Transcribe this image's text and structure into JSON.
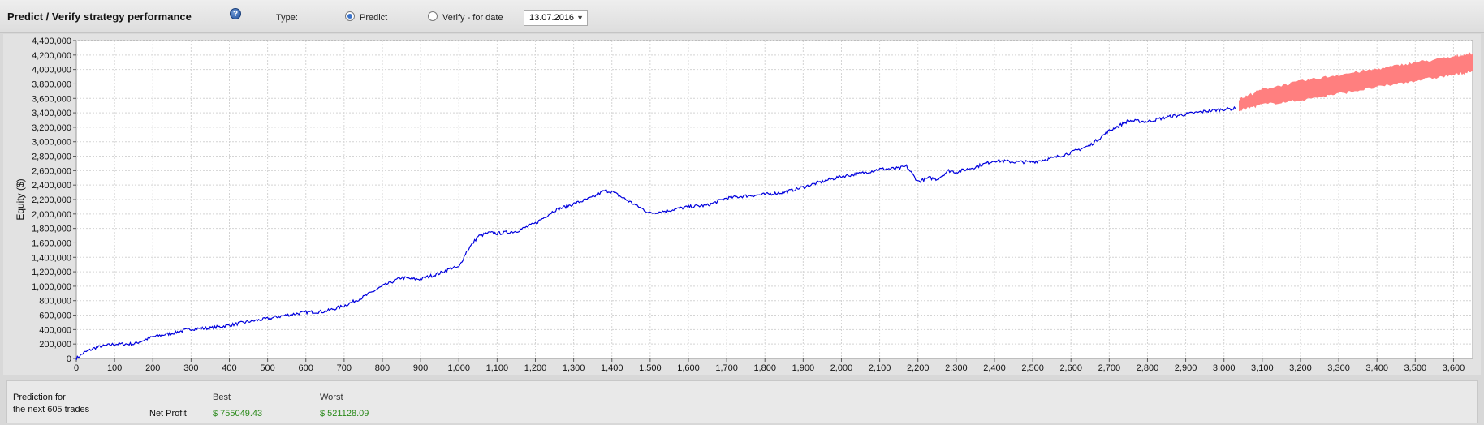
{
  "header": {
    "title": "Predict / Verify strategy performance",
    "help_icon": "?",
    "type_label": "Type:",
    "predict_label": "Predict",
    "verify_label": "Verify - for date",
    "date_value": "13.07.2016",
    "selected_type": "Predict"
  },
  "chart_data": {
    "type": "line",
    "ylabel": "Equity ($)",
    "xlabel": "",
    "xlim": [
      0,
      3650
    ],
    "ylim": [
      0,
      4400000
    ],
    "x_ticks": [
      0,
      100,
      200,
      300,
      400,
      500,
      600,
      700,
      800,
      900,
      1000,
      1100,
      1200,
      1300,
      1400,
      1500,
      1600,
      1700,
      1800,
      1900,
      2000,
      2100,
      2200,
      2300,
      2400,
      2500,
      2600,
      2700,
      2800,
      2900,
      3000,
      3100,
      3200,
      3300,
      3400,
      3500,
      3600
    ],
    "x_tick_labels": [
      "0",
      "100",
      "200",
      "300",
      "400",
      "500",
      "600",
      "700",
      "800",
      "900",
      "1,000",
      "1,100",
      "1,200",
      "1,300",
      "1,400",
      "1,500",
      "1,600",
      "1,700",
      "1,800",
      "1,900",
      "2,000",
      "2,100",
      "2,200",
      "2,300",
      "2,400",
      "2,500",
      "2,600",
      "2,700",
      "2,800",
      "2,900",
      "3,000",
      "3,100",
      "3,200",
      "3,300",
      "3,400",
      "3,500",
      "3,600"
    ],
    "y_ticks": [
      0,
      200000,
      400000,
      600000,
      800000,
      1000000,
      1200000,
      1400000,
      1600000,
      1800000,
      2000000,
      2200000,
      2400000,
      2600000,
      2800000,
      3000000,
      3200000,
      3400000,
      3600000,
      3800000,
      4000000,
      4200000,
      4400000
    ],
    "y_tick_labels": [
      "0",
      "200,000",
      "400,000",
      "600,000",
      "800,000",
      "1,000,000",
      "1,200,000",
      "1,400,000",
      "1,600,000",
      "1,800,000",
      "2,000,000",
      "2,200,000",
      "2,400,000",
      "2,600,000",
      "2,800,000",
      "3,000,000",
      "3,200,000",
      "3,400,000",
      "3,600,000",
      "3,800,000",
      "4,000,000",
      "4,200,000",
      "4,400,000"
    ],
    "grid": true,
    "series": [
      {
        "color": "#0000dd",
        "x": [
          0,
          20,
          50,
          100,
          150,
          200,
          250,
          300,
          350,
          400,
          450,
          500,
          550,
          600,
          650,
          700,
          750,
          800,
          850,
          880,
          900,
          950,
          980,
          1000,
          1020,
          1050,
          1080,
          1100,
          1150,
          1200,
          1250,
          1300,
          1350,
          1380,
          1400,
          1450,
          1500,
          1550,
          1600,
          1650,
          1700,
          1750,
          1800,
          1850,
          1900,
          1950,
          2000,
          2050,
          2100,
          2150,
          2170,
          2200,
          2230,
          2250,
          2280,
          2300,
          2350,
          2400,
          2450,
          2500,
          2550,
          2600,
          2650,
          2700,
          2750,
          2800,
          2850,
          2900,
          2950,
          3000,
          3030
        ],
        "y": [
          0,
          80000,
          150000,
          200000,
          200000,
          300000,
          350000,
          410000,
          420000,
          460000,
          510000,
          550000,
          600000,
          640000,
          650000,
          730000,
          850000,
          1000000,
          1120000,
          1100000,
          1100000,
          1180000,
          1250000,
          1260000,
          1480000,
          1690000,
          1740000,
          1730000,
          1760000,
          1870000,
          2050000,
          2140000,
          2230000,
          2320000,
          2310000,
          2160000,
          2010000,
          2050000,
          2100000,
          2120000,
          2220000,
          2250000,
          2270000,
          2300000,
          2370000,
          2450000,
          2520000,
          2560000,
          2620000,
          2630000,
          2660000,
          2450000,
          2500000,
          2480000,
          2600000,
          2580000,
          2650000,
          2740000,
          2720000,
          2720000,
          2770000,
          2850000,
          2950000,
          3150000,
          3290000,
          3280000,
          3340000,
          3380000,
          3420000,
          3450000,
          3460000
        ]
      },
      {
        "color": "#ff7f7f",
        "x": [
          3040,
          3100,
          3200,
          3300,
          3400,
          3500,
          3600,
          3650
        ],
        "y_high": [
          3580000,
          3720000,
          3830000,
          3920000,
          4000000,
          4090000,
          4170000,
          4220000
        ],
        "y_low": [
          3440000,
          3520000,
          3580000,
          3670000,
          3760000,
          3850000,
          3930000,
          3980000
        ]
      }
    ]
  },
  "summary": {
    "prediction_label_line1": "Prediction for",
    "prediction_label_line2": "the next 605 trades",
    "best_header": "Best",
    "worst_header": "Worst",
    "net_profit_label": "Net Profit",
    "best_value": "$ 755049.43",
    "worst_value": "$ 521128.09"
  }
}
